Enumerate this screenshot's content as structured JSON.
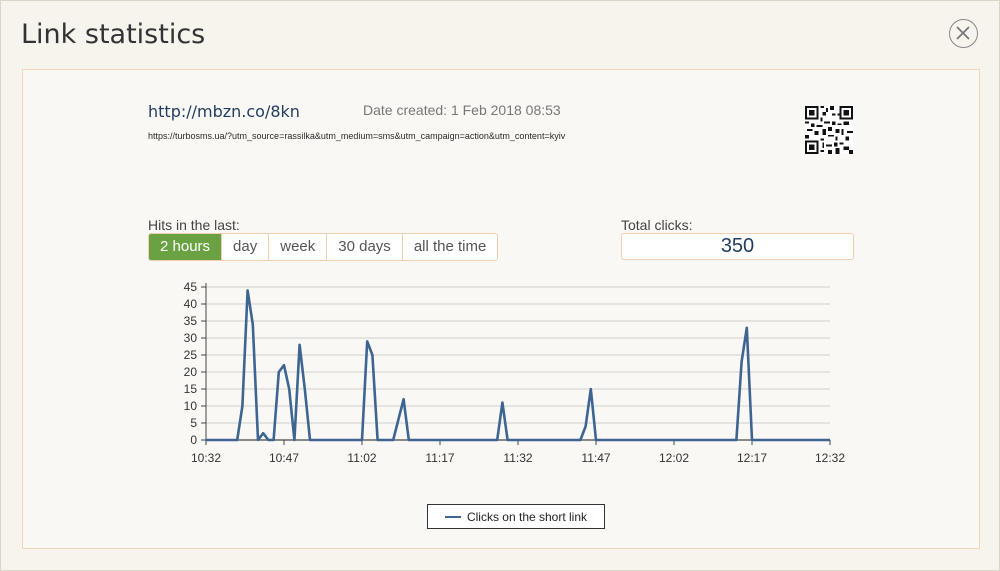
{
  "modal": {
    "title": "Link statistics"
  },
  "link": {
    "short_url": "http://mbzn.co/8kn",
    "date_created": "Date created: 1 Feb 2018 08:53",
    "long_url": "https://turbosms.ua/?utm_source=rassilka&utm_medium=sms&utm_campaign=action&utm_content=kyiv"
  },
  "icons": {
    "close": "close-icon",
    "qr": "qr-code-icon"
  },
  "hits": {
    "label": "Hits in the last:",
    "ranges": [
      "2 hours",
      "day",
      "week",
      "30 days",
      "all the time"
    ],
    "selected": "2 hours"
  },
  "total": {
    "label": "Total clicks:",
    "value": "350"
  },
  "colors": {
    "accent": "#6aa243",
    "line": "#3e6591",
    "link": "#1f3b5e",
    "border": "#efcfaf"
  },
  "chart_data": {
    "type": "line",
    "title": "",
    "xlabel": "",
    "ylabel": "",
    "ylim": [
      0,
      45
    ],
    "yticks": [
      "0",
      "5",
      "10",
      "15",
      "20",
      "25",
      "30",
      "35",
      "40",
      "45"
    ],
    "xticks": [
      "10:32",
      "10:47",
      "11:02",
      "11:17",
      "11:32",
      "11:47",
      "12:02",
      "12:17",
      "12:32"
    ],
    "xlim_minutes": [
      0,
      120
    ],
    "grid": true,
    "legend_position": "bottom-center",
    "series": [
      {
        "name": "Clicks on the short link",
        "points": [
          [
            0,
            0
          ],
          [
            6,
            0
          ],
          [
            7,
            10
          ],
          [
            8,
            44
          ],
          [
            9,
            34
          ],
          [
            10,
            0
          ],
          [
            11,
            2
          ],
          [
            12,
            0
          ],
          [
            13,
            0
          ],
          [
            14,
            20
          ],
          [
            15,
            22
          ],
          [
            16,
            15
          ],
          [
            17,
            0
          ],
          [
            18,
            28
          ],
          [
            19,
            15
          ],
          [
            20,
            0
          ],
          [
            30,
            0
          ],
          [
            31,
            29
          ],
          [
            32,
            25
          ],
          [
            33,
            0
          ],
          [
            36,
            0
          ],
          [
            37,
            6
          ],
          [
            38,
            12
          ],
          [
            39,
            0
          ],
          [
            56,
            0
          ],
          [
            57,
            11
          ],
          [
            58,
            0
          ],
          [
            72,
            0
          ],
          [
            73,
            4
          ],
          [
            74,
            15
          ],
          [
            75,
            0
          ],
          [
            102,
            0
          ],
          [
            103,
            23
          ],
          [
            104,
            33
          ],
          [
            105,
            0
          ],
          [
            120,
            0
          ]
        ]
      }
    ]
  }
}
